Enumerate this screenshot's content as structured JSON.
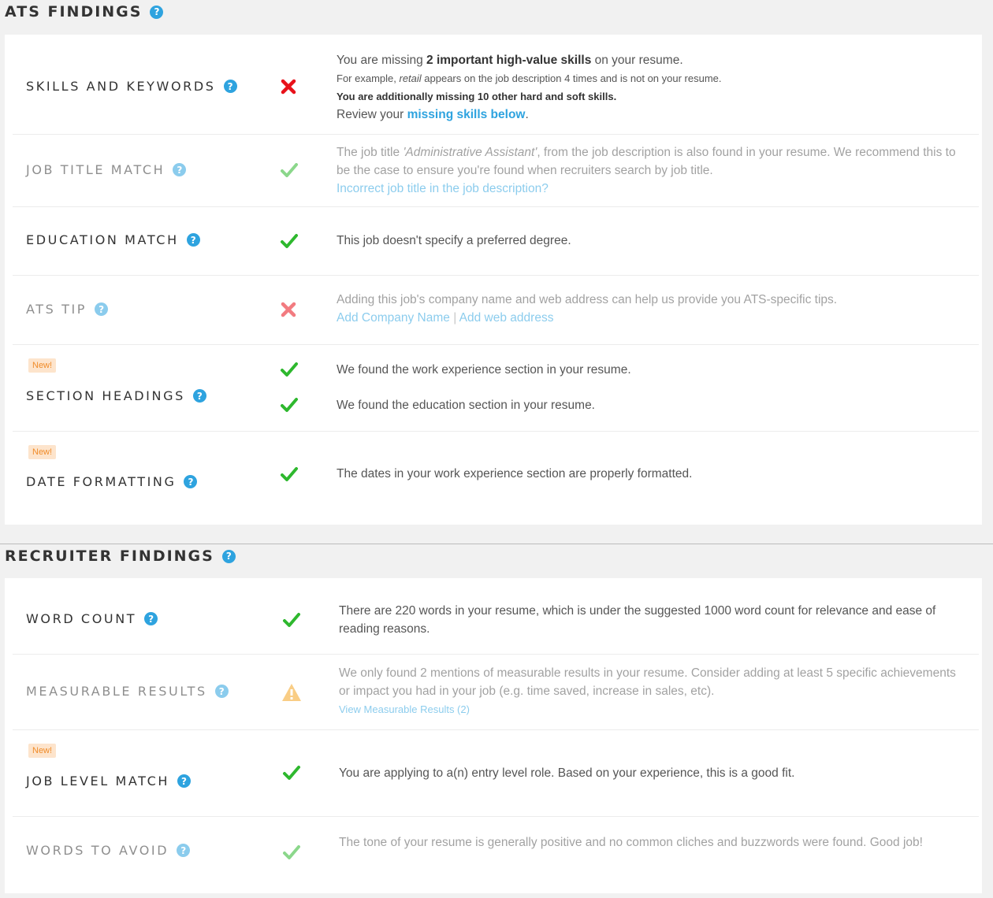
{
  "ats": {
    "title": "ATS FINDINGS",
    "rows": {
      "skills": {
        "label": "SKILLS AND KEYWORDS",
        "line1_pre": "You are missing ",
        "line1_bold": "2 important high-value skills",
        "line1_post": " on your resume.",
        "line2_pre": "For example, ",
        "line2_em": "retail",
        "line2_post": " appears on the job description 4 times and is not on your resume.",
        "line3": "You are additionally missing 10 other hard and soft skills.",
        "line4_pre": "Review your ",
        "line4_link": "missing skills below",
        "line4_post": "."
      },
      "job_title": {
        "label": "JOB TITLE MATCH",
        "text_pre": "The job title ",
        "text_em": "'Administrative Assistant'",
        "text_post": ", from the job description is also found in your resume. We recommend this to be the case to ensure you're found when recruiters search by job title.",
        "link": "Incorrect job title in the job description?"
      },
      "education": {
        "label": "EDUCATION MATCH",
        "text": "This job doesn't specify a preferred degree."
      },
      "ats_tip": {
        "label": "ATS TIP",
        "text": "Adding this job's company name and web address can help us provide you ATS-specific tips.",
        "link1": "Add Company Name",
        "sep": "|",
        "link2": "Add web address"
      },
      "section_headings": {
        "badge": "New!",
        "label": "SECTION HEADINGS",
        "text1": "We found the work experience section in your resume.",
        "text2": "We found the education section in your resume."
      },
      "date_formatting": {
        "badge": "New!",
        "label": "DATE FORMATTING",
        "text": "The dates in your work experience section are properly formatted."
      }
    }
  },
  "recruiter": {
    "title": "RECRUITER FINDINGS",
    "rows": {
      "word_count": {
        "label": "WORD COUNT",
        "text": "There are 220 words in your resume, which is under the suggested 1000 word count for relevance and ease of reading reasons."
      },
      "measurable": {
        "label": "MEASURABLE RESULTS",
        "text": "We only found 2 mentions of measurable results in your resume. Consider adding at least 5 specific achievements or impact you had in your job (e.g. time saved, increase in sales, etc).",
        "link": "View Measurable Results (2)"
      },
      "job_level": {
        "badge": "New!",
        "label": "JOB LEVEL MATCH",
        "text": "You are applying to a(n) entry level role. Based on your experience, this is a good fit."
      },
      "words_avoid": {
        "label": "WORDS TO AVOID",
        "text": "The tone of your resume is generally positive and no common cliches and buzzwords were found. Good job!"
      }
    }
  },
  "help_glyph": "?",
  "colors": {
    "accent": "#2ea3df",
    "check": "#2eb82e",
    "cross": "#e8111a",
    "warning": "#f5a623",
    "badge_bg": "#fde4cc",
    "badge_text": "#f08c2a"
  }
}
